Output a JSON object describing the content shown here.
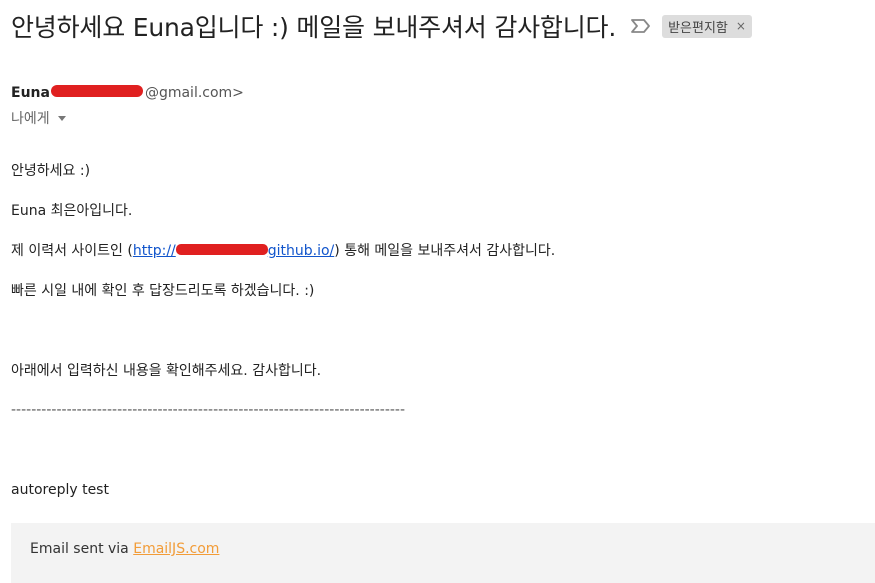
{
  "email": {
    "subject": "안녕하세요 Euna입니다 :) 메일을 보내주셔서 감사합니다.",
    "label": "받은편지함",
    "label_close": "×",
    "sender_name": "Euna",
    "sender_email_suffix": "@gmail.com>",
    "to_text": "나에게",
    "greeting": "안녕하세요 :)",
    "intro": "Euna 최은아입니다.",
    "visit_prefix": "제 이력서 사이트인 (",
    "link_start": "http://",
    "link_end": "github.io/",
    "visit_suffix": ") 통해 메일을 보내주셔서 감사합니다.",
    "reply_promise": "빠른 시일 내에 확인 후 답장드리도록 하겠습니다. :)",
    "check_content": "아래에서 입력하신 내용을 확인해주세요. 감사합니다.",
    "divider": "------------------------------------------------------------------------------",
    "message_body": "autoreply test",
    "footer_prefix": "Email sent via ",
    "footer_link": "EmailJS.com"
  },
  "icons": {
    "important": "important-marker-icon",
    "to_caret": "caret-down-icon"
  },
  "colors": {
    "link": "#1155cc",
    "footer_link": "#f29c38",
    "redaction": "#e02020",
    "label_bg": "#dddddd"
  }
}
